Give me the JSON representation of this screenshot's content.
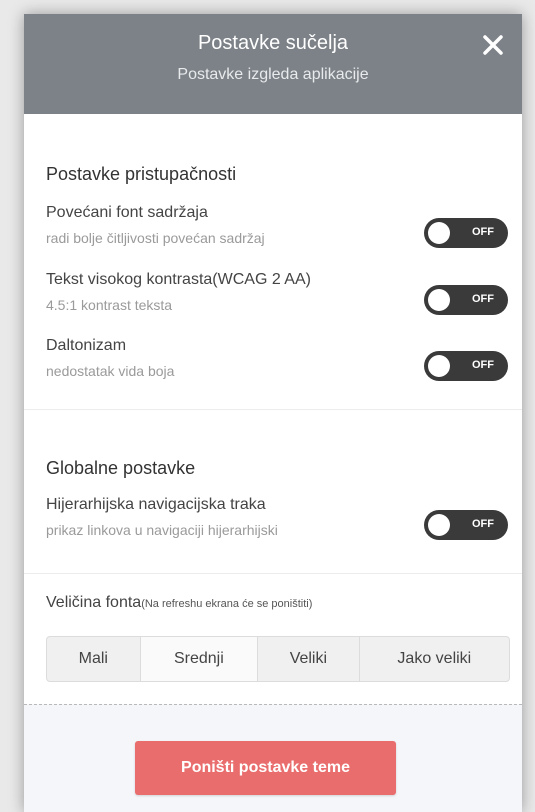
{
  "header": {
    "title": "Postavke sučelja",
    "subtitle": "Postavke izgleda aplikacije",
    "close_icon": "close-icon"
  },
  "accessibility": {
    "title": "Postavke pristupačnosti",
    "items": [
      {
        "label": "Povećani font sadržaja",
        "desc": "radi bolje čitljivosti povećan sadržaj",
        "state": "OFF"
      },
      {
        "label": "Tekst visokog kontrasta(WCAG 2 AA)",
        "desc": "4.5:1 kontrast teksta",
        "state": "OFF"
      },
      {
        "label": "Daltonizam",
        "desc": "nedostatak vida boja",
        "state": "OFF"
      }
    ]
  },
  "global": {
    "title": "Globalne postavke",
    "items": [
      {
        "label": "Hijerarhijska navigacijska traka",
        "desc": "prikaz linkova u navigaciji hijerarhijski",
        "state": "OFF"
      }
    ]
  },
  "font_size": {
    "label": "Veličina fonta",
    "note": "(Na refreshu ekrana će se poništiti)",
    "options": [
      "Mali",
      "Srednji",
      "Veliki",
      "Jako veliki"
    ],
    "selected": "Srednji"
  },
  "reset_label": "Poništi postavke teme",
  "colors": {
    "header_bg": "#7c8288",
    "toggle_bg": "#3a3a3a",
    "reset_bg": "#ea6d6d"
  }
}
